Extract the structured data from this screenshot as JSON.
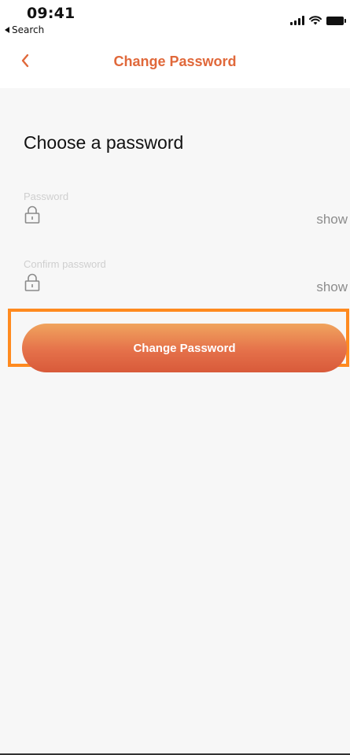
{
  "status_bar": {
    "time": "09:41",
    "back_app": "Search"
  },
  "nav": {
    "title": "Change Password",
    "back_icon": "chevron-left-icon"
  },
  "form": {
    "heading": "Choose a password",
    "password": {
      "label": "Password",
      "value": "",
      "toggle": "show",
      "icon": "lock-icon"
    },
    "confirm_password": {
      "label": "Confirm password",
      "value": "",
      "toggle": "show",
      "icon": "lock-icon"
    },
    "submit_label": "Change Password"
  },
  "colors": {
    "accent": "#e0683a",
    "highlight": "#ff8a1f",
    "background": "#f7f7f7"
  }
}
